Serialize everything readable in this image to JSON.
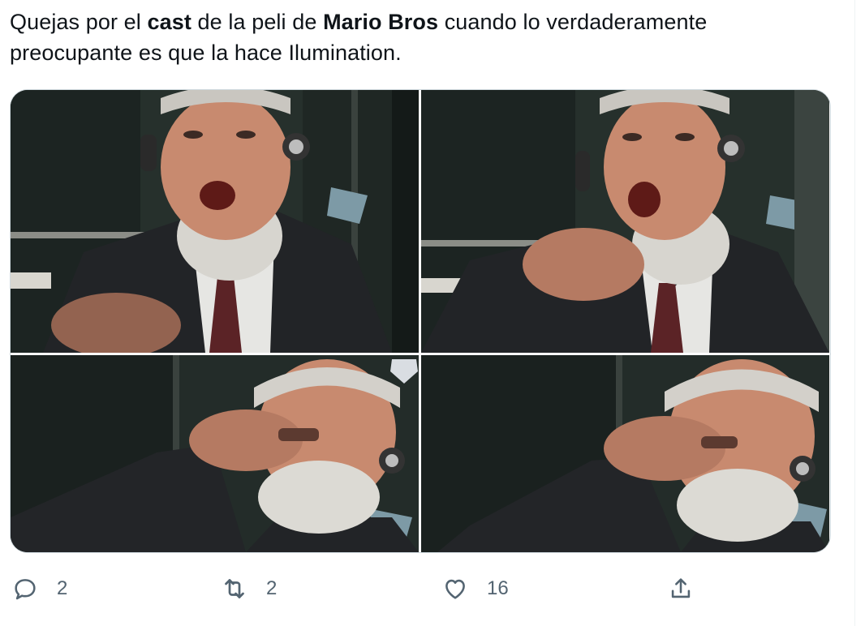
{
  "tweet": {
    "text_parts": {
      "p1": "Quejas por el ",
      "b1": "cast",
      "p2": " de la peli de ",
      "b2": "Mario Bros",
      "p3": " cuando lo verdaderamente preocupante es que la hace Ilumination."
    }
  },
  "actions": {
    "reply": {
      "icon": "reply-icon",
      "count": "2"
    },
    "retweet": {
      "icon": "retweet-icon",
      "count": "2"
    },
    "like": {
      "icon": "heart-icon",
      "count": "16"
    },
    "share": {
      "icon": "share-icon"
    }
  },
  "colors": {
    "text": "#0f1419",
    "secondary": "#536471",
    "border": "#cfd9de"
  }
}
